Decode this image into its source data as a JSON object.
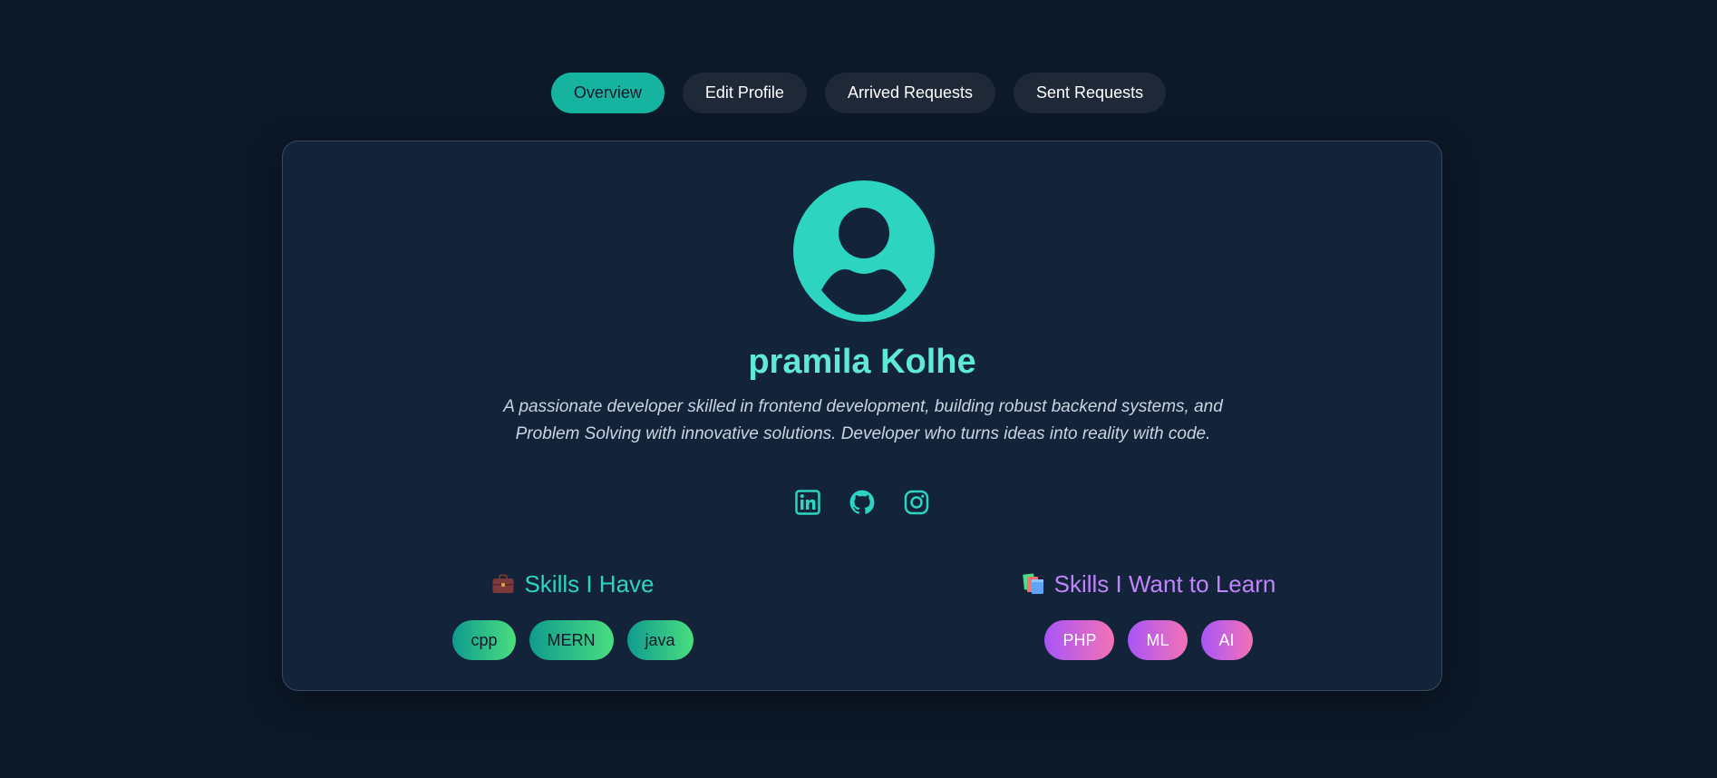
{
  "tabs": [
    {
      "label": "Overview",
      "active": true
    },
    {
      "label": "Edit Profile",
      "active": false
    },
    {
      "label": "Arrived Requests",
      "active": false
    },
    {
      "label": "Sent Requests",
      "active": false
    }
  ],
  "profile": {
    "avatar_icon": "user-avatar-icon",
    "name": "pramila Kolhe",
    "bio": "A passionate developer skilled in frontend development, building robust backend systems, and Problem Solving with innovative solutions. Developer who turns ideas into reality with code."
  },
  "socials": [
    {
      "icon": "linkedin-icon"
    },
    {
      "icon": "github-icon"
    },
    {
      "icon": "instagram-icon"
    }
  ],
  "skills_have": {
    "icon": "briefcase-icon",
    "title": "Skills I Have",
    "items": [
      "cpp",
      "MERN",
      "java"
    ]
  },
  "skills_learn": {
    "icon": "books-icon",
    "title": "Skills I Want to Learn",
    "items": [
      "PHP",
      "ML",
      "AI"
    ]
  },
  "colors": {
    "background": "#0c1929",
    "card": "#12233a",
    "accent_teal": "#2dd4bf",
    "accent_purple": "#c084fc"
  }
}
